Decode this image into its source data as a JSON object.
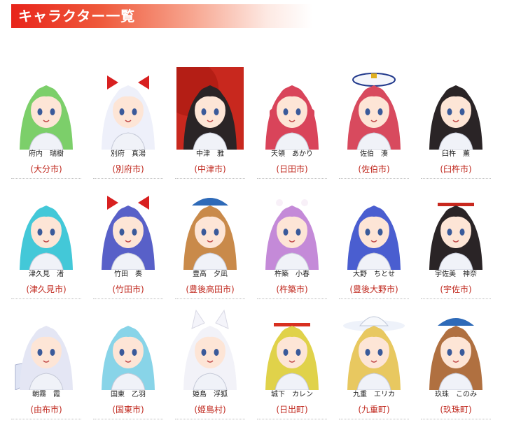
{
  "header": {
    "title": "キャラクター一覧",
    "accent_color": "#e8241a"
  },
  "characters": [
    {
      "name": "府内　瑞樹",
      "city": "(大分市)",
      "hair": "#7ccf6a",
      "bg": "#ffffff",
      "accessory": "none"
    },
    {
      "name": "別府　真湯",
      "city": "(別府市)",
      "hair": "#eef0fa",
      "bg": "#ffffff",
      "accessory": "ribbon-red"
    },
    {
      "name": "中津　雅",
      "city": "(中津市)",
      "hair": "#2a2426",
      "bg": "#c8281e",
      "accessory": "umbrella"
    },
    {
      "name": "天領　あかり",
      "city": "(日田市)",
      "hair": "#d9445a",
      "bg": "#ffffff",
      "accessory": "braids"
    },
    {
      "name": "佐伯　湊",
      "city": "(佐伯市)",
      "hair": "#d84a5e",
      "bg": "#ffffff",
      "accessory": "sailor-cap"
    },
    {
      "name": "臼杵　薫",
      "city": "(臼杵市)",
      "hair": "#2a2426",
      "bg": "#ffffff",
      "accessory": "kimono"
    },
    {
      "name": "津久見　渚",
      "city": "(津久見市)",
      "hair": "#43c8d8",
      "bg": "#ffffff",
      "accessory": "none"
    },
    {
      "name": "竹田　奏",
      "city": "(竹田市)",
      "hair": "#5860c8",
      "bg": "#ffffff",
      "accessory": "ribbon-red"
    },
    {
      "name": "豊高　夕凪",
      "city": "(豊後高田市)",
      "hair": "#c98a4a",
      "bg": "#ffffff",
      "accessory": "cap-blue"
    },
    {
      "name": "杵築　小春",
      "city": "(杵築市)",
      "hair": "#c48ad8",
      "bg": "#ffffff",
      "accessory": "flowers"
    },
    {
      "name": "大野　ちとせ",
      "city": "(豊後大野市)",
      "hair": "#4a5ed0",
      "bg": "#ffffff",
      "accessory": "none"
    },
    {
      "name": "宇佐美　神奈",
      "city": "(宇佐市)",
      "hair": "#2a2426",
      "bg": "#ffffff",
      "accessory": "headband"
    },
    {
      "name": "朝霧　霞",
      "city": "(由布市)",
      "hair": "#e4e6f4",
      "bg": "#ffffff",
      "accessory": "fan"
    },
    {
      "name": "国東　乙羽",
      "city": "(国東市)",
      "hair": "#88d4e8",
      "bg": "#ffffff",
      "accessory": "none"
    },
    {
      "name": "姫島　浮狐",
      "city": "(姫島村)",
      "hair": "#f2f2f8",
      "bg": "#ffffff",
      "accessory": "fox-ears"
    },
    {
      "name": "城下　カレン",
      "city": "(日出町)",
      "hair": "#e0d24a",
      "bg": "#ffffff",
      "accessory": "headband-red"
    },
    {
      "name": "九重　エリカ",
      "city": "(九重町)",
      "hair": "#e8c860",
      "bg": "#ffffff",
      "accessory": "cowboy-hat"
    },
    {
      "name": "玖珠　このみ",
      "city": "(玖珠町)",
      "hair": "#b07040",
      "bg": "#ffffff",
      "accessory": "cap-blue"
    }
  ]
}
